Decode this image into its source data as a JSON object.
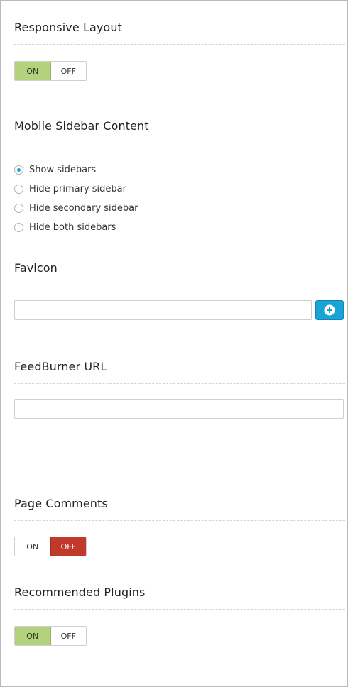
{
  "sections": {
    "responsive_layout": {
      "title": "Responsive Layout",
      "on_label": "ON",
      "off_label": "OFF",
      "value": "ON"
    },
    "mobile_sidebar": {
      "title": "Mobile Sidebar Content",
      "options": [
        {
          "label": "Show sidebars",
          "checked": true
        },
        {
          "label": "Hide primary sidebar",
          "checked": false
        },
        {
          "label": "Hide secondary sidebar",
          "checked": false
        },
        {
          "label": "Hide both sidebars",
          "checked": false
        }
      ]
    },
    "favicon": {
      "title": "Favicon",
      "value": "",
      "add_icon": "plus-circle-icon"
    },
    "feedburner": {
      "title": "FeedBurner URL",
      "value": ""
    },
    "page_comments": {
      "title": "Page Comments",
      "on_label": "ON",
      "off_label": "OFF",
      "value": "OFF"
    },
    "recommended_plugins": {
      "title": "Recommended Plugins",
      "on_label": "ON",
      "off_label": "OFF",
      "value": "ON"
    }
  },
  "colors": {
    "toggle_on": "#b3d27e",
    "toggle_off": "#c0392b",
    "accent": "#1aa3d8"
  }
}
